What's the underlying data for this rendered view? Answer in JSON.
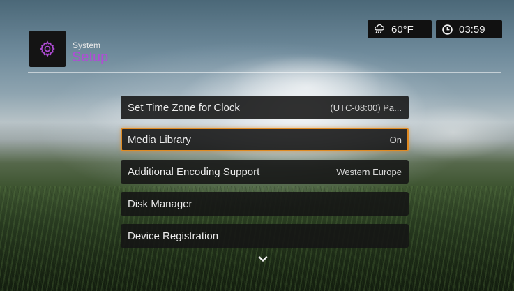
{
  "header": {
    "section": "System",
    "title": "Setup",
    "icon": "gear-icon",
    "accent_color": "#b04cd6"
  },
  "status": {
    "weather": {
      "icon": "cloud-rain-icon",
      "value": "60°F"
    },
    "clock": {
      "icon": "clock-icon",
      "value": "03:59"
    }
  },
  "menu": {
    "items": [
      {
        "label": "Set Time Zone for Clock",
        "value": "(UTC-08:00) Pa..."
      },
      {
        "label": "Media Library",
        "value": "On",
        "selected": true
      },
      {
        "label": "Additional Encoding Support",
        "value": "Western Europe"
      },
      {
        "label": "Disk Manager",
        "value": ""
      },
      {
        "label": "Device Registration",
        "value": ""
      }
    ],
    "more_icon": "chevron-down-icon",
    "selection_color": "#e08a22"
  }
}
